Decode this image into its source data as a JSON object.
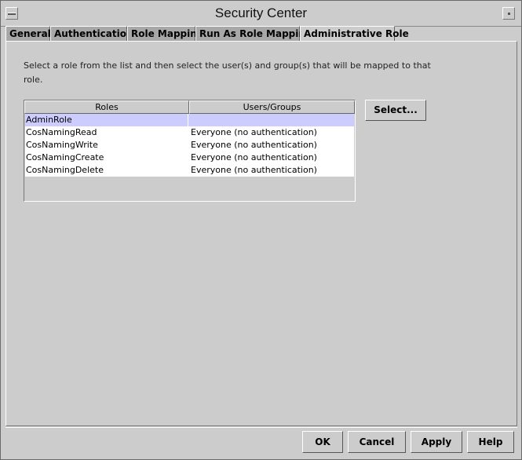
{
  "window": {
    "title": "Security Center"
  },
  "tabs": [
    {
      "label": "General"
    },
    {
      "label": "Authentication"
    },
    {
      "label": "Role Mapping"
    },
    {
      "label": "Run As Role Mapping"
    },
    {
      "label": "Administrative Role"
    }
  ],
  "active_tab": "Administrative Role",
  "instruction": "Select a role from the list and then select the user(s) and group(s) that will be mapped to that role.",
  "table": {
    "columns": [
      "Roles",
      "Users/Groups"
    ],
    "rows": [
      {
        "role": "AdminRole",
        "users": ""
      },
      {
        "role": "CosNamingRead",
        "users": "Everyone (no authentication)"
      },
      {
        "role": "CosNamingWrite",
        "users": "Everyone (no authentication)"
      },
      {
        "role": "CosNamingCreate",
        "users": "Everyone (no authentication)"
      },
      {
        "role": "CosNamingDelete",
        "users": "Everyone (no authentication)"
      }
    ],
    "selected_row": "AdminRole"
  },
  "select_button": "Select...",
  "footer": {
    "ok": "OK",
    "cancel": "Cancel",
    "apply": "Apply",
    "help": "Help"
  },
  "colors": {
    "selection": "#ccccff",
    "window_bg": "#cccccc",
    "inactive_tab": "#a8a8a8"
  }
}
